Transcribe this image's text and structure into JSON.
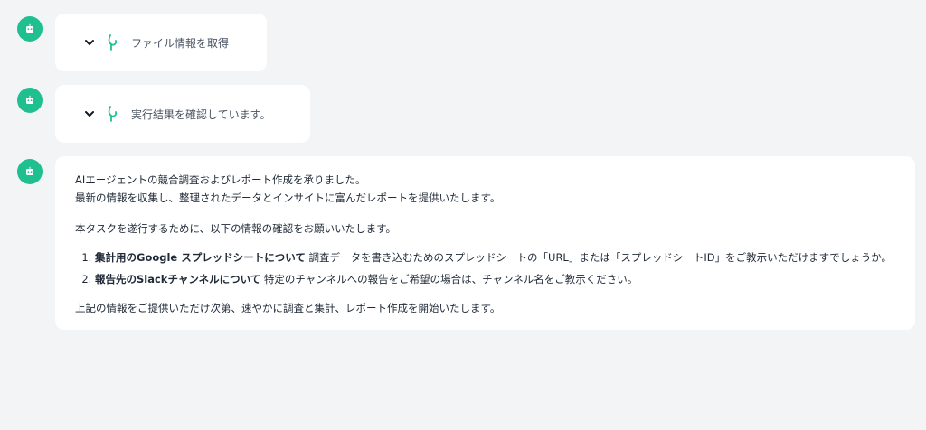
{
  "colors": {
    "page_background": "#f3f4f6",
    "avatar": "#1fbf8f",
    "card": "#ffffff",
    "tool_icon": "#1fbf8f"
  },
  "avatar_icon": "bot-face-icon",
  "steps": [
    {
      "icon": "chevron-down-icon",
      "tool_icon": "tool-sprout-icon",
      "label": "ファイル情報を取得"
    },
    {
      "icon": "chevron-down-icon",
      "tool_icon": "tool-sprout-icon",
      "label": "実行結果を確認しています。"
    }
  ],
  "message": {
    "intro_line1": "AIエージェントの競合調査およびレポート作成を承りました。",
    "intro_line2": "最新の情報を収集し、整理されたデータとインサイトに富んだレポートを提供いたします。",
    "request": "本タスクを遂行するために、以下の情報の確認をお願いいたします。",
    "items": [
      {
        "title": "集計用のGoogle スプレッドシートについて",
        "body": " 調査データを書き込むためのスプレッドシートの「URL」または「スプレッドシートID」をご教示いただけますでしょうか。"
      },
      {
        "title": "報告先のSlackチャンネルについて",
        "body": " 特定のチャンネルへの報告をご希望の場合は、チャンネル名をご教示ください。"
      }
    ],
    "closing": "上記の情報をご提供いただけ次第、速やかに調査と集計、レポート作成を開始いたします。"
  }
}
